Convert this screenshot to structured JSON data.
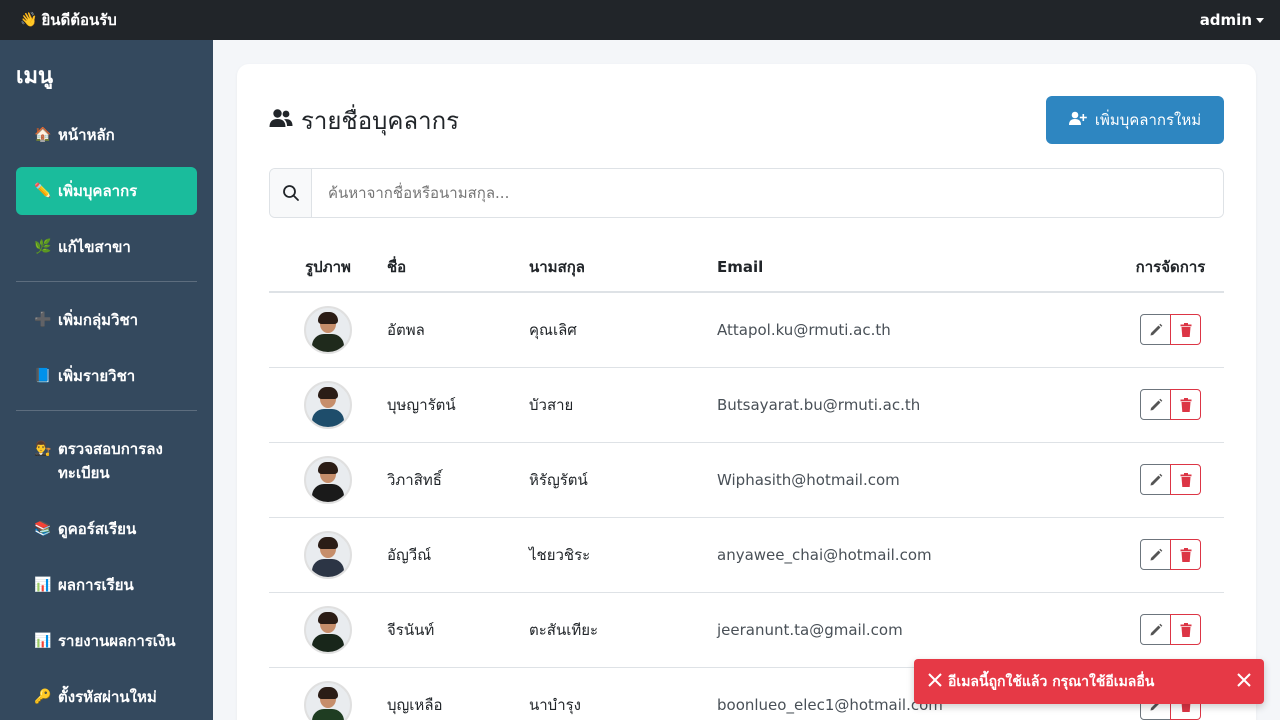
{
  "topbar": {
    "brand_icon": "waving-hand-icon",
    "brand": "ยินดีต้อนรับ",
    "user": "admin"
  },
  "sidebar": {
    "title": "เมนู",
    "items": [
      {
        "label": "หน้าหลัก",
        "icon": "🏠"
      },
      {
        "label": "เพิ่มบุคลากร",
        "icon": "✏️",
        "active": true
      },
      {
        "label": "แก้ไขสาขา",
        "icon": "🌿"
      },
      {
        "label": "เพิ่มกลุ่มวิชา",
        "icon": "➕"
      },
      {
        "label": "เพิ่มรายวิชา",
        "icon": "📘"
      },
      {
        "label": "ตรวจสอบการลงทะเบียน",
        "icon": "👨‍⚖️"
      },
      {
        "label": "ดูคอร์สเรียน",
        "icon": "📚"
      },
      {
        "label": "ผลการเรียน",
        "icon": "📊"
      },
      {
        "label": "รายงานผลการเงิน",
        "icon": "📊"
      },
      {
        "label": "ตั้งรหัสผ่านใหม่",
        "icon": "🔑"
      }
    ]
  },
  "main": {
    "title": "รายชื่อบุคลากร",
    "add_button": "เพิ่มบุคลากรใหม่",
    "search_placeholder": "ค้นหาจากชื่อหรือนามสกุล...",
    "columns": [
      "รูปภาพ",
      "ชื่อ",
      "นามสกุล",
      "Email",
      "การจัดการ"
    ],
    "rows": [
      {
        "first": "อัตพล",
        "last": "คุณเลิศ",
        "email": "Attapol.ku@rmuti.ac.th"
      },
      {
        "first": "บุษญารัตน์",
        "last": "บัวสาย",
        "email": "Butsayarat.bu@rmuti.ac.th"
      },
      {
        "first": "วิภาสิทธิ์",
        "last": "หิรัญรัตน์",
        "email": "Wiphasith@hotmail.com"
      },
      {
        "first": "อัญวีณ์",
        "last": "ไชยวชิระ",
        "email": "anyawee_chai@hotmail.com"
      },
      {
        "first": "จีรนันท์",
        "last": "ตะสันเทียะ",
        "email": "jeeranunt.ta@gmail.com"
      },
      {
        "first": "บุญเหลือ",
        "last": "นาบำรุง",
        "email": "boonlueo_elec1@hotmail.com"
      }
    ]
  },
  "toast": {
    "message": "อีเมลนี้ถูกใช้แล้ว กรุณาใช้อีเมลอื่น"
  },
  "colors": {
    "accent": "#1abc9c",
    "primary": "#2e86c1",
    "danger": "#e63946",
    "sidebar": "#34495e"
  }
}
